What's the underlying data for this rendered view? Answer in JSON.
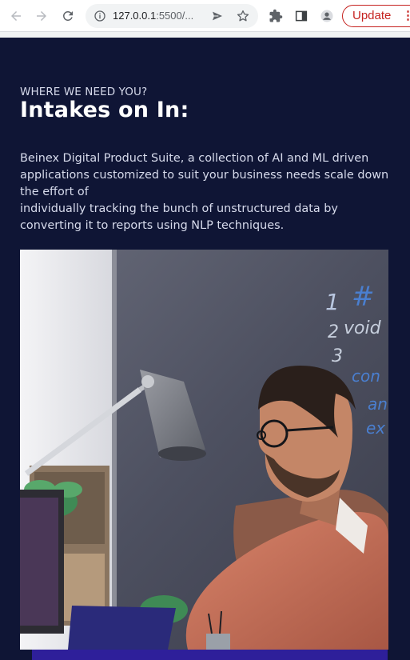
{
  "browser": {
    "url_host": "127.0.0.1",
    "url_rest": ":5500/...",
    "update_label": "Update",
    "icons": [
      "back-arrow-icon",
      "forward-arrow-icon",
      "reload-icon",
      "info-icon",
      "send-icon",
      "star-icon",
      "extensions-icon",
      "side-panel-icon",
      "profile-icon",
      "more-vert-icon"
    ]
  },
  "section": {
    "eyebrow": "WHERE WE NEED YOU?",
    "heading": "Intakes on In:",
    "intro_lines": [
      "Beinex Digital Product Suite, a collection of AI and ML driven",
      "applications customized to suit your business needs scale down",
      "the effort of",
      "individually tracking the bunch of unstructured data by",
      "converting it to reports using NLP techniques."
    ],
    "chalkboard_text": [
      "1",
      "#",
      "2",
      "void",
      "3",
      "con",
      "an",
      "ex"
    ]
  },
  "colors": {
    "page_background": "#0f1535",
    "accent_bar": "#2e1f9a",
    "update_red": "#c5221f"
  }
}
